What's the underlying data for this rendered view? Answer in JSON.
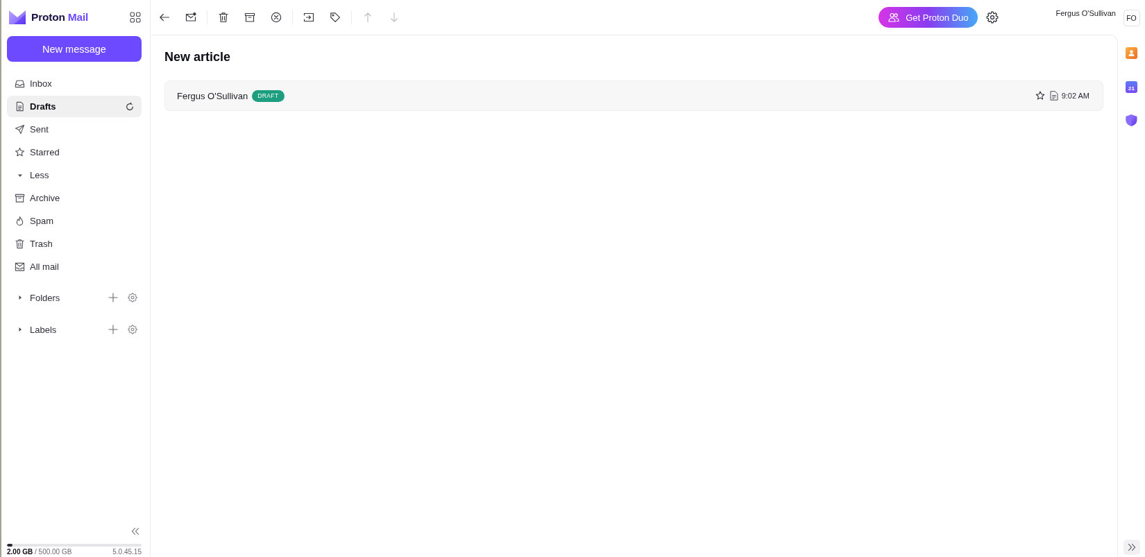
{
  "sidebar": {
    "logo": {
      "brand": "Proton",
      "product": "Mail"
    },
    "compose_button": "New message",
    "items": [
      {
        "kind": "inbox",
        "label": "Inbox",
        "selected": false
      },
      {
        "kind": "drafts",
        "label": "Drafts",
        "selected": true
      },
      {
        "kind": "sent",
        "label": "Sent",
        "selected": false
      },
      {
        "kind": "starred",
        "label": "Starred",
        "selected": false
      }
    ],
    "more_toggle": {
      "label": "Less",
      "expanded": true
    },
    "more_items": [
      {
        "kind": "archive",
        "label": "Archive",
        "selected": false
      },
      {
        "kind": "spam",
        "label": "Spam",
        "selected": false
      },
      {
        "kind": "trash",
        "label": "Trash",
        "selected": false
      },
      {
        "kind": "all-mail",
        "label": "All mail",
        "selected": false
      }
    ],
    "sections": [
      {
        "label": "Folders",
        "expanded": false
      },
      {
        "label": "Labels",
        "expanded": false
      }
    ],
    "storage": {
      "usage": "**2.00 GB** / 500.00 GB",
      "level": 0.04
    },
    "version": "5.0.45.15"
  },
  "toolbar": {
    "previous": {
      "disabled": true
    },
    "next": {
      "disabled": true
    }
  },
  "header": {
    "upgrade_button": "Get Proton Duo",
    "user_name": "Fergus O'Sullivan",
    "user_initials": "FO"
  },
  "conversation": {
    "title": "New article",
    "messages": [
      {
        "sender": "Fergus O'Sullivan",
        "badge": "DRAFT",
        "starred": false,
        "time": "9:02 AM"
      }
    ]
  },
  "apps": {
    "calendar_day": "21"
  }
}
